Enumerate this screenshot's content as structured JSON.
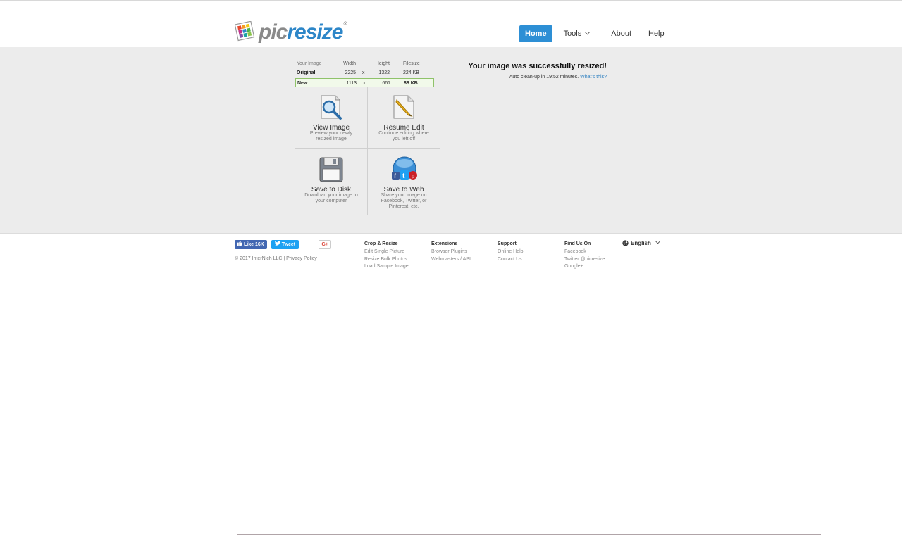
{
  "brand": {
    "name_pic": "pic",
    "name_resize": "resize",
    "reg_mark": "®",
    "colors": {
      "blue": "#2d86c8",
      "grey": "#8a8a8a"
    }
  },
  "nav": {
    "items": [
      {
        "label": "Home",
        "active": true
      },
      {
        "label": "Tools",
        "has_dropdown": true
      },
      {
        "label": "About"
      },
      {
        "label": "Help"
      }
    ],
    "active_color": "#2d8fd5"
  },
  "image_info": {
    "headers": {
      "label": "Your Image",
      "width": "Width",
      "height": "Height",
      "filesize": "Filesize"
    },
    "original": {
      "label": "Original",
      "width": "2225",
      "x": "x",
      "height": "1322",
      "filesize": "224 KB"
    },
    "new": {
      "label": "New",
      "width": "1113",
      "x": "x",
      "height": "661",
      "filesize": "88 KB"
    }
  },
  "actions": [
    {
      "title": "View Image",
      "desc": "Preview your newly resized image",
      "icon": "magnifier-icon"
    },
    {
      "title": "Resume Edit",
      "desc": "Continue editing where you left off",
      "icon": "pencil-document-icon"
    },
    {
      "title": "Save to Disk",
      "desc": "Download your image to your computer",
      "icon": "floppy-disk-icon"
    },
    {
      "title": "Save to Web",
      "desc": "Share your image on Facebook, Twitter, or Pinterest, etc.",
      "icon": "social-globe-icon"
    }
  ],
  "status": {
    "title": "Your image was successfully resized!",
    "cleanup": "Auto clean-up in 19:52 minutes.",
    "whats_this": "What's this?"
  },
  "social": {
    "like": "Like 16K",
    "tweet": "Tweet",
    "gplus": "G+"
  },
  "footer": {
    "copyright": "© 2017 InterNich LLC | Privacy Policy",
    "columns": [
      {
        "title": "Crop & Resize",
        "links": [
          "Edit Single Picture",
          "Resize Bulk Photos",
          "Load Sample Image"
        ]
      },
      {
        "title": "Extensions",
        "links": [
          "Browser Plugins",
          "Webmasters / API"
        ]
      },
      {
        "title": "Support",
        "links": [
          "Online Help",
          "Contact Us"
        ]
      },
      {
        "title": "Find Us On",
        "links": [
          "Facebook",
          "Twitter @picresize",
          "Google+"
        ]
      }
    ],
    "language": "English"
  }
}
